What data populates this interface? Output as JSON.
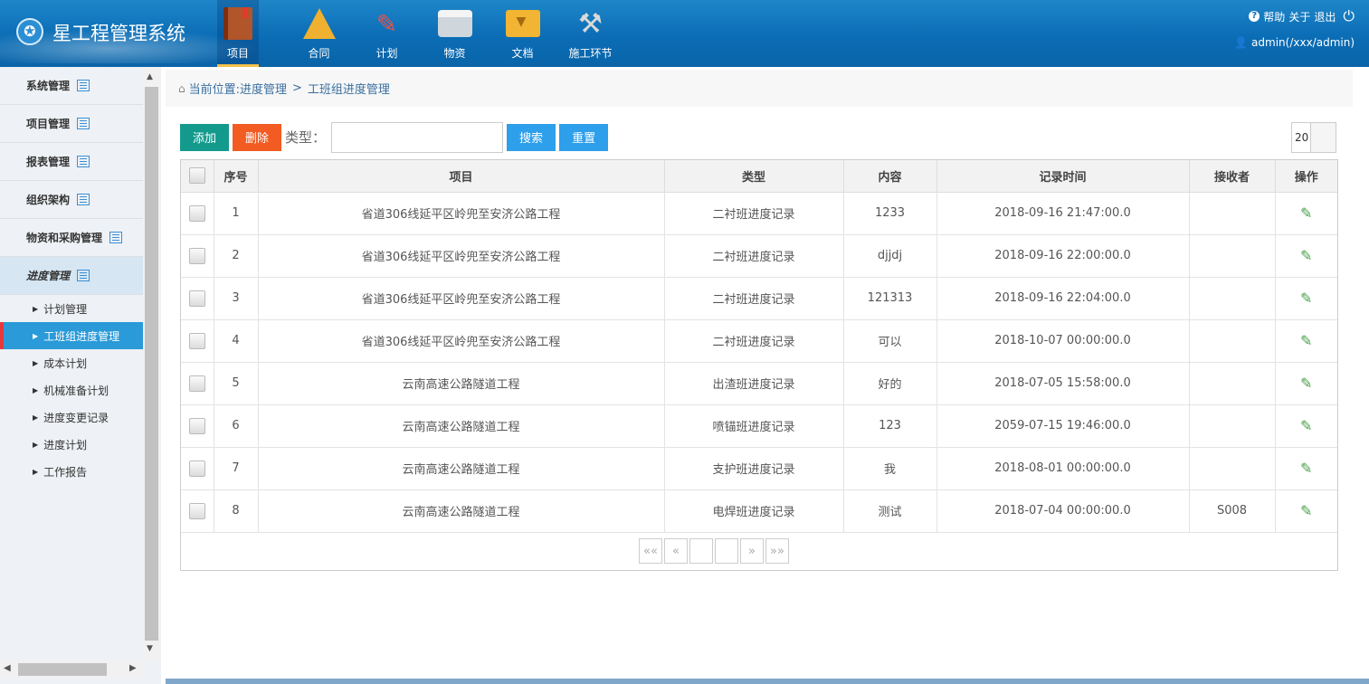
{
  "app": {
    "title": "星工程管理系统"
  },
  "nav": [
    {
      "label": "项目",
      "icon": "book-icon"
    },
    {
      "label": "合同",
      "icon": "triangle-ruler-icon"
    },
    {
      "label": "计划",
      "icon": "drafting-tools-icon"
    },
    {
      "label": "物资",
      "icon": "printer-icon"
    },
    {
      "label": "文档",
      "icon": "folder-icon"
    },
    {
      "label": "施工环节",
      "icon": "tools-icon"
    }
  ],
  "header_right": {
    "help": "帮助",
    "about": "关于",
    "logout": "退出",
    "user": "admin(/xxx/admin)"
  },
  "sidebar": {
    "groups": [
      "系统管理",
      "项目管理",
      "报表管理",
      "组织架构",
      "物资和采购管理",
      "进度管理"
    ],
    "items": [
      "计划管理",
      "工班组进度管理",
      "成本计划",
      "机械准备计划",
      "进度变更记录",
      "进度计划",
      "工作报告"
    ]
  },
  "breadcrumb": {
    "prefix": "当前位置:进度管理",
    "sep": ">",
    "current": "工班组进度管理"
  },
  "toolbar": {
    "add": "添加",
    "delete": "删除",
    "type_label": "类型：",
    "search": "搜索",
    "reset": "重置",
    "page_size": "20"
  },
  "table": {
    "headers": [
      "序号",
      "项目",
      "类型",
      "内容",
      "记录时间",
      "接收者",
      "操作"
    ],
    "rows": [
      {
        "no": "1",
        "project": "省道306线延平区岭兜至安济公路工程",
        "type": "二衬班进度记录",
        "content": "1233",
        "time": "2018-09-16 21:47:00.0",
        "receiver": ""
      },
      {
        "no": "2",
        "project": "省道306线延平区岭兜至安济公路工程",
        "type": "二衬班进度记录",
        "content": "djjdj",
        "time": "2018-09-16 22:00:00.0",
        "receiver": ""
      },
      {
        "no": "3",
        "project": "省道306线延平区岭兜至安济公路工程",
        "type": "二衬班进度记录",
        "content": "121313",
        "time": "2018-09-16 22:04:00.0",
        "receiver": ""
      },
      {
        "no": "4",
        "project": "省道306线延平区岭兜至安济公路工程",
        "type": "二衬班进度记录",
        "content": "可以",
        "time": "2018-10-07 00:00:00.0",
        "receiver": ""
      },
      {
        "no": "5",
        "project": "云南高速公路隧道工程",
        "type": "出渣班进度记录",
        "content": "好的",
        "time": "2018-07-05 15:58:00.0",
        "receiver": ""
      },
      {
        "no": "6",
        "project": "云南高速公路隧道工程",
        "type": "喷锚班进度记录",
        "content": "123",
        "time": "2059-07-15 19:46:00.0",
        "receiver": ""
      },
      {
        "no": "7",
        "project": "云南高速公路隧道工程",
        "type": "支护班进度记录",
        "content": "我",
        "time": "2018-08-01 00:00:00.0",
        "receiver": ""
      },
      {
        "no": "8",
        "project": "云南高速公路隧道工程",
        "type": "电焊班进度记录",
        "content": "测试",
        "time": "2018-07-04 00:00:00.0",
        "receiver": "S008"
      }
    ]
  },
  "pager": {
    "first": "««",
    "prev": "«",
    "next": "»",
    "last": "»»"
  }
}
